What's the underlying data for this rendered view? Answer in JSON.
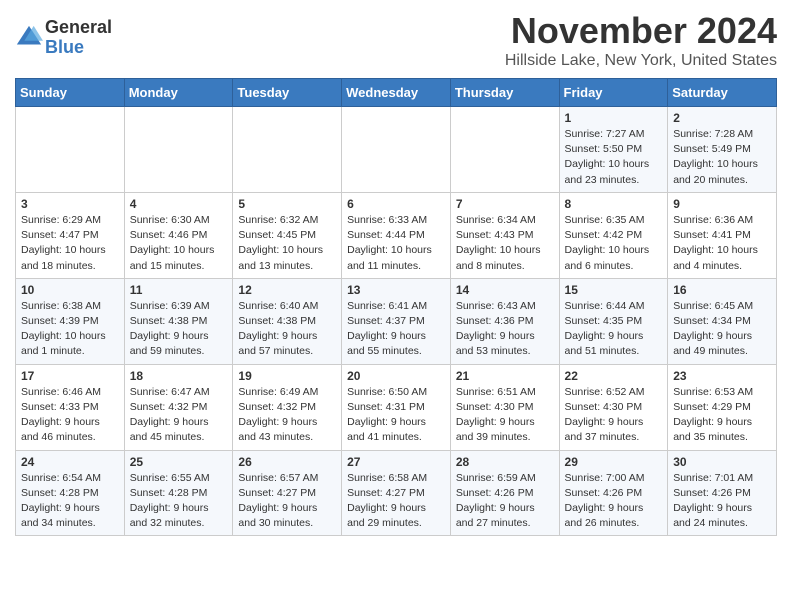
{
  "logo": {
    "line1": "General",
    "line2": "Blue"
  },
  "title": "November 2024",
  "location": "Hillside Lake, New York, United States",
  "days_of_week": [
    "Sunday",
    "Monday",
    "Tuesday",
    "Wednesday",
    "Thursday",
    "Friday",
    "Saturday"
  ],
  "weeks": [
    [
      {
        "day": null
      },
      {
        "day": null
      },
      {
        "day": null
      },
      {
        "day": null
      },
      {
        "day": null
      },
      {
        "day": "1",
        "sunrise": "Sunrise: 7:27 AM",
        "sunset": "Sunset: 5:50 PM",
        "daylight": "Daylight: 10 hours and 23 minutes."
      },
      {
        "day": "2",
        "sunrise": "Sunrise: 7:28 AM",
        "sunset": "Sunset: 5:49 PM",
        "daylight": "Daylight: 10 hours and 20 minutes."
      }
    ],
    [
      {
        "day": "3",
        "sunrise": "Sunrise: 6:29 AM",
        "sunset": "Sunset: 4:47 PM",
        "daylight": "Daylight: 10 hours and 18 minutes."
      },
      {
        "day": "4",
        "sunrise": "Sunrise: 6:30 AM",
        "sunset": "Sunset: 4:46 PM",
        "daylight": "Daylight: 10 hours and 15 minutes."
      },
      {
        "day": "5",
        "sunrise": "Sunrise: 6:32 AM",
        "sunset": "Sunset: 4:45 PM",
        "daylight": "Daylight: 10 hours and 13 minutes."
      },
      {
        "day": "6",
        "sunrise": "Sunrise: 6:33 AM",
        "sunset": "Sunset: 4:44 PM",
        "daylight": "Daylight: 10 hours and 11 minutes."
      },
      {
        "day": "7",
        "sunrise": "Sunrise: 6:34 AM",
        "sunset": "Sunset: 4:43 PM",
        "daylight": "Daylight: 10 hours and 8 minutes."
      },
      {
        "day": "8",
        "sunrise": "Sunrise: 6:35 AM",
        "sunset": "Sunset: 4:42 PM",
        "daylight": "Daylight: 10 hours and 6 minutes."
      },
      {
        "day": "9",
        "sunrise": "Sunrise: 6:36 AM",
        "sunset": "Sunset: 4:41 PM",
        "daylight": "Daylight: 10 hours and 4 minutes."
      }
    ],
    [
      {
        "day": "10",
        "sunrise": "Sunrise: 6:38 AM",
        "sunset": "Sunset: 4:39 PM",
        "daylight": "Daylight: 10 hours and 1 minute."
      },
      {
        "day": "11",
        "sunrise": "Sunrise: 6:39 AM",
        "sunset": "Sunset: 4:38 PM",
        "daylight": "Daylight: 9 hours and 59 minutes."
      },
      {
        "day": "12",
        "sunrise": "Sunrise: 6:40 AM",
        "sunset": "Sunset: 4:38 PM",
        "daylight": "Daylight: 9 hours and 57 minutes."
      },
      {
        "day": "13",
        "sunrise": "Sunrise: 6:41 AM",
        "sunset": "Sunset: 4:37 PM",
        "daylight": "Daylight: 9 hours and 55 minutes."
      },
      {
        "day": "14",
        "sunrise": "Sunrise: 6:43 AM",
        "sunset": "Sunset: 4:36 PM",
        "daylight": "Daylight: 9 hours and 53 minutes."
      },
      {
        "day": "15",
        "sunrise": "Sunrise: 6:44 AM",
        "sunset": "Sunset: 4:35 PM",
        "daylight": "Daylight: 9 hours and 51 minutes."
      },
      {
        "day": "16",
        "sunrise": "Sunrise: 6:45 AM",
        "sunset": "Sunset: 4:34 PM",
        "daylight": "Daylight: 9 hours and 49 minutes."
      }
    ],
    [
      {
        "day": "17",
        "sunrise": "Sunrise: 6:46 AM",
        "sunset": "Sunset: 4:33 PM",
        "daylight": "Daylight: 9 hours and 46 minutes."
      },
      {
        "day": "18",
        "sunrise": "Sunrise: 6:47 AM",
        "sunset": "Sunset: 4:32 PM",
        "daylight": "Daylight: 9 hours and 45 minutes."
      },
      {
        "day": "19",
        "sunrise": "Sunrise: 6:49 AM",
        "sunset": "Sunset: 4:32 PM",
        "daylight": "Daylight: 9 hours and 43 minutes."
      },
      {
        "day": "20",
        "sunrise": "Sunrise: 6:50 AM",
        "sunset": "Sunset: 4:31 PM",
        "daylight": "Daylight: 9 hours and 41 minutes."
      },
      {
        "day": "21",
        "sunrise": "Sunrise: 6:51 AM",
        "sunset": "Sunset: 4:30 PM",
        "daylight": "Daylight: 9 hours and 39 minutes."
      },
      {
        "day": "22",
        "sunrise": "Sunrise: 6:52 AM",
        "sunset": "Sunset: 4:30 PM",
        "daylight": "Daylight: 9 hours and 37 minutes."
      },
      {
        "day": "23",
        "sunrise": "Sunrise: 6:53 AM",
        "sunset": "Sunset: 4:29 PM",
        "daylight": "Daylight: 9 hours and 35 minutes."
      }
    ],
    [
      {
        "day": "24",
        "sunrise": "Sunrise: 6:54 AM",
        "sunset": "Sunset: 4:28 PM",
        "daylight": "Daylight: 9 hours and 34 minutes."
      },
      {
        "day": "25",
        "sunrise": "Sunrise: 6:55 AM",
        "sunset": "Sunset: 4:28 PM",
        "daylight": "Daylight: 9 hours and 32 minutes."
      },
      {
        "day": "26",
        "sunrise": "Sunrise: 6:57 AM",
        "sunset": "Sunset: 4:27 PM",
        "daylight": "Daylight: 9 hours and 30 minutes."
      },
      {
        "day": "27",
        "sunrise": "Sunrise: 6:58 AM",
        "sunset": "Sunset: 4:27 PM",
        "daylight": "Daylight: 9 hours and 29 minutes."
      },
      {
        "day": "28",
        "sunrise": "Sunrise: 6:59 AM",
        "sunset": "Sunset: 4:26 PM",
        "daylight": "Daylight: 9 hours and 27 minutes."
      },
      {
        "day": "29",
        "sunrise": "Sunrise: 7:00 AM",
        "sunset": "Sunset: 4:26 PM",
        "daylight": "Daylight: 9 hours and 26 minutes."
      },
      {
        "day": "30",
        "sunrise": "Sunrise: 7:01 AM",
        "sunset": "Sunset: 4:26 PM",
        "daylight": "Daylight: 9 hours and 24 minutes."
      }
    ]
  ]
}
